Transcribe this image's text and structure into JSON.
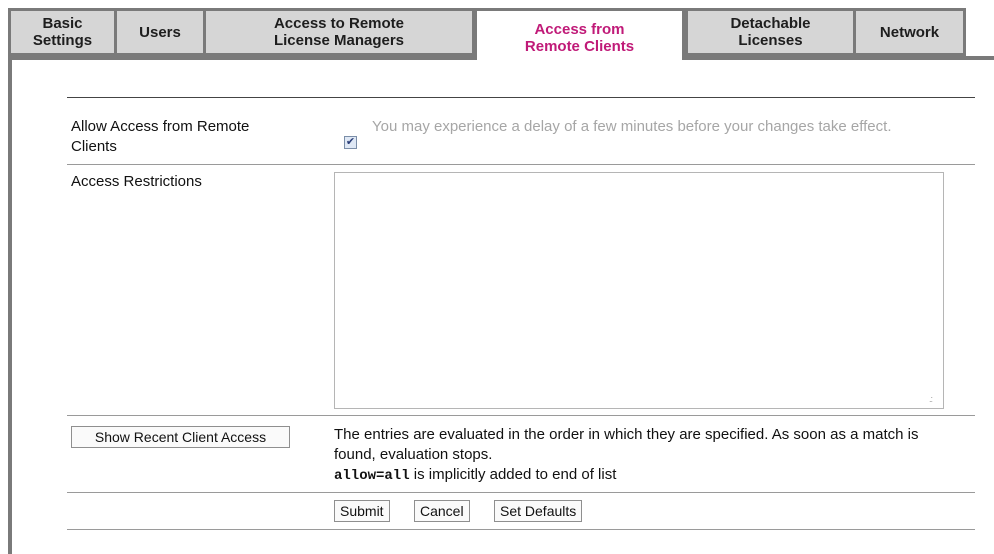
{
  "tabs": [
    {
      "line1": "Basic",
      "line2": "Settings",
      "active": false
    },
    {
      "line1": "Users",
      "line2": "",
      "active": false
    },
    {
      "line1": "Access to Remote",
      "line2": "License Managers",
      "active": false
    },
    {
      "line1": "Access from",
      "line2": "Remote Clients",
      "active": true
    },
    {
      "line1": "Detachable",
      "line2": "Licenses",
      "active": false
    },
    {
      "line1": "Network",
      "line2": "",
      "active": false
    }
  ],
  "form": {
    "allow_access_label_1": "Allow Access from Remote",
    "allow_access_label_2": "Clients",
    "allow_access_checked": true,
    "allow_access_help": "You may experience a delay of a few minutes before your changes take effect.",
    "restrictions_label": "Access Restrictions",
    "restrictions_value": "",
    "show_recent_button": "Show Recent Client Access",
    "note_line": "The entries are evaluated in the order in which they are specified. As soon as a match is found, evaluation stops.",
    "note_code": "allow=all",
    "note_tail": " is implicitly added to end of list",
    "submit_button": "Submit",
    "cancel_button": "Cancel",
    "defaults_button": "Set Defaults"
  },
  "colors": {
    "active_tab_text": "#c01a78",
    "tab_bg": "#d6d6d6",
    "tab_border": "#7a7a7a",
    "help_text": "#a6a6a6"
  }
}
